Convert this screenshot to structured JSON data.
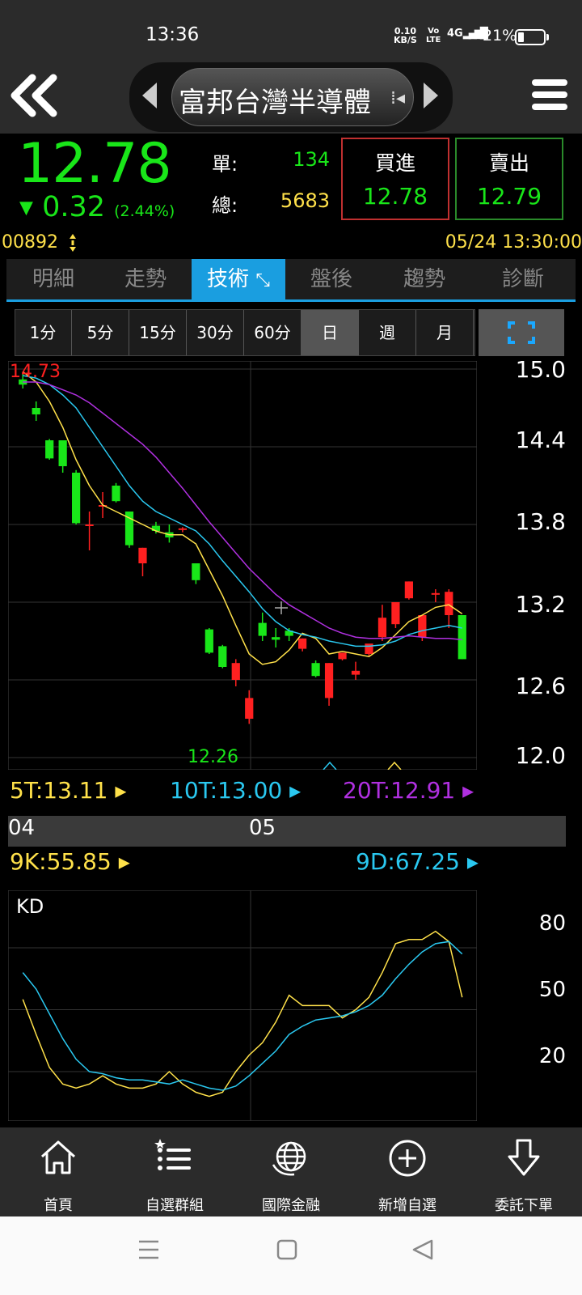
{
  "status": {
    "time": "13:36",
    "net_speed": "0.10",
    "net_unit": "KB/S",
    "volte_top": "Vo",
    "volte_bottom": "LTE",
    "signal": "4G",
    "battery": "21%"
  },
  "header": {
    "title": "富邦台灣半導體"
  },
  "quote": {
    "price": "12.78",
    "change": "0.32",
    "change_pct": "(2.44%)",
    "unit_label": "單:",
    "unit_value": "134",
    "total_label": "總:",
    "total_value": "5683",
    "buy_label": "買進",
    "buy_price": "12.78",
    "sell_label": "賣出",
    "sell_price": "12.79"
  },
  "info": {
    "code": "00892",
    "datetime": "05/24 13:30:00"
  },
  "tabs": [
    "明細",
    "走勢",
    "技術",
    "盤後",
    "趨勢",
    "診斷"
  ],
  "active_tab": "技術",
  "periods": [
    "1分",
    "5分",
    "15分",
    "30分",
    "60分",
    "日",
    "週",
    "月"
  ],
  "selected_period": "日",
  "colors": {
    "up": "#ff2020",
    "down": "#19e619",
    "ma5": "#ffe14a",
    "ma10": "#2ac8f0",
    "ma20": "#b030e0",
    "accent": "#1a9ee0"
  },
  "chart_data": [
    {
      "type": "candlestick",
      "ylim": [
        12.0,
        15.0
      ],
      "y_ticks": [
        "15.0",
        "14.4",
        "13.8",
        "13.2",
        "12.6",
        "12.0"
      ],
      "high_label": "14.73",
      "low_label": "12.26",
      "x_ticks": [
        "04",
        "05"
      ],
      "candles": [
        {
          "o": 14.92,
          "h": 14.98,
          "l": 14.85,
          "c": 14.88
        },
        {
          "o": 14.7,
          "h": 14.75,
          "l": 14.6,
          "c": 14.65
        },
        {
          "o": 14.45,
          "h": 14.46,
          "l": 14.3,
          "c": 14.31
        },
        {
          "o": 14.45,
          "h": 14.45,
          "l": 14.2,
          "c": 14.25
        },
        {
          "o": 14.2,
          "h": 14.22,
          "l": 13.8,
          "c": 13.81
        },
        {
          "o": 13.8,
          "h": 13.9,
          "l": 13.6,
          "c": 13.8
        },
        {
          "o": 13.95,
          "h": 14.05,
          "l": 13.85,
          "c": 13.95
        },
        {
          "o": 14.1,
          "h": 14.12,
          "l": 13.97,
          "c": 13.98
        },
        {
          "o": 13.9,
          "h": 13.9,
          "l": 13.62,
          "c": 13.64
        },
        {
          "o": 13.5,
          "h": 13.62,
          "l": 13.4,
          "c": 13.62
        },
        {
          "o": 13.79,
          "h": 13.82,
          "l": 13.73,
          "c": 13.75
        },
        {
          "o": 13.74,
          "h": 13.8,
          "l": 13.66,
          "c": 13.7
        },
        {
          "o": 13.76,
          "h": 13.78,
          "l": 13.74,
          "c": 13.77
        },
        {
          "o": 13.5,
          "h": 13.5,
          "l": 13.34,
          "c": 13.37
        },
        {
          "o": 12.99,
          "h": 13.0,
          "l": 12.8,
          "c": 12.81
        },
        {
          "o": 12.86,
          "h": 12.87,
          "l": 12.69,
          "c": 12.7
        },
        {
          "o": 12.6,
          "h": 12.76,
          "l": 12.55,
          "c": 12.73
        },
        {
          "o": 12.3,
          "h": 12.52,
          "l": 12.26,
          "c": 12.46
        },
        {
          "o": 13.04,
          "h": 13.12,
          "l": 12.9,
          "c": 12.94
        },
        {
          "o": 12.93,
          "h": 13.0,
          "l": 12.85,
          "c": 12.91
        },
        {
          "o": 12.98,
          "h": 13.0,
          "l": 12.9,
          "c": 12.94
        },
        {
          "o": 12.84,
          "h": 12.92,
          "l": 12.82,
          "c": 12.92
        },
        {
          "o": 12.73,
          "h": 12.75,
          "l": 12.62,
          "c": 12.63
        },
        {
          "o": 12.46,
          "h": 12.73,
          "l": 12.4,
          "c": 12.73
        },
        {
          "o": 12.76,
          "h": 12.81,
          "l": 12.75,
          "c": 12.81
        },
        {
          "o": 12.64,
          "h": 12.74,
          "l": 12.6,
          "c": 12.67
        },
        {
          "o": 12.8,
          "h": 12.86,
          "l": 12.78,
          "c": 12.88
        },
        {
          "o": 12.93,
          "h": 13.18,
          "l": 12.9,
          "c": 13.08
        },
        {
          "o": 13.03,
          "h": 13.07,
          "l": 13.0,
          "c": 13.2
        },
        {
          "o": 13.23,
          "h": 13.36,
          "l": 13.22,
          "c": 13.36
        },
        {
          "o": 12.93,
          "h": 13.1,
          "l": 12.9,
          "c": 13.1
        },
        {
          "o": 13.27,
          "h": 13.3,
          "l": 13.2,
          "c": 13.27
        },
        {
          "o": 13.1,
          "h": 13.3,
          "l": 13.0,
          "c": 13.28
        },
        {
          "o": 13.1,
          "h": 13.1,
          "l": 12.76,
          "c": 12.76
        }
      ],
      "ma": [
        {
          "name": "5T",
          "value": "13.11",
          "color": "#ffe14a",
          "values": [
            14.98,
            14.9,
            14.75,
            14.55,
            14.3,
            14.1,
            13.95,
            13.9,
            13.85,
            13.8,
            13.75,
            13.72,
            13.72,
            13.65,
            13.45,
            13.25,
            13.02,
            12.8,
            12.72,
            12.74,
            12.83,
            12.96,
            12.92,
            12.8,
            12.82,
            12.8,
            12.78,
            12.85,
            12.95,
            13.05,
            13.1,
            13.16,
            13.18,
            13.11
          ]
        },
        {
          "name": "10T",
          "value": "13.00",
          "color": "#2ac8f0",
          "values": [
            14.95,
            14.93,
            14.88,
            14.8,
            14.7,
            14.55,
            14.4,
            14.25,
            14.1,
            13.98,
            13.9,
            13.85,
            13.8,
            13.75,
            13.65,
            13.52,
            13.4,
            13.28,
            13.15,
            13.05,
            12.98,
            12.95,
            12.93,
            12.9,
            12.88,
            12.86,
            12.86,
            12.87,
            12.9,
            12.95,
            12.98,
            13.0,
            13.02,
            13.0
          ]
        },
        {
          "name": "20T",
          "value": "12.91",
          "color": "#b030e0",
          "values": [
            14.9,
            14.9,
            14.88,
            14.84,
            14.8,
            14.74,
            14.66,
            14.58,
            14.5,
            14.42,
            14.32,
            14.2,
            14.08,
            13.95,
            13.82,
            13.7,
            13.58,
            13.46,
            13.36,
            13.26,
            13.18,
            13.12,
            13.06,
            13.0,
            12.96,
            12.93,
            12.92,
            12.92,
            12.93,
            12.94,
            12.93,
            12.92,
            12.92,
            12.91
          ]
        }
      ]
    },
    {
      "type": "line",
      "title": "KD",
      "ylim": [
        0,
        100
      ],
      "y_ticks": [
        "80",
        "50",
        "20"
      ],
      "series": [
        {
          "name": "9K",
          "value": "55.85",
          "color": "#ffe14a",
          "values": [
            55,
            38,
            22,
            14,
            12,
            14,
            18,
            14,
            12,
            12,
            14,
            20,
            14,
            10,
            8,
            10,
            20,
            28,
            34,
            44,
            57,
            52,
            52,
            52,
            46,
            50,
            56,
            68,
            82,
            84,
            84,
            88,
            83,
            56
          ]
        },
        {
          "name": "9D",
          "value": "67.25",
          "color": "#2ac8f0",
          "values": [
            68,
            60,
            48,
            36,
            26,
            20,
            19,
            17,
            16,
            16,
            15,
            14,
            16,
            14,
            12,
            11,
            13,
            18,
            24,
            30,
            38,
            42,
            45,
            46,
            47,
            49,
            52,
            57,
            65,
            72,
            78,
            82,
            83,
            77
          ]
        }
      ]
    }
  ],
  "ma_labels": [
    {
      "text": "5T:13.11"
    },
    {
      "text": "10T:13.00"
    },
    {
      "text": "20T:12.91"
    }
  ],
  "kd_labels": [
    {
      "text": "9K:55.85"
    },
    {
      "text": "9D:67.25"
    }
  ],
  "nav": [
    "首頁",
    "自選群組",
    "國際金融",
    "新增自選",
    "委託下單"
  ]
}
